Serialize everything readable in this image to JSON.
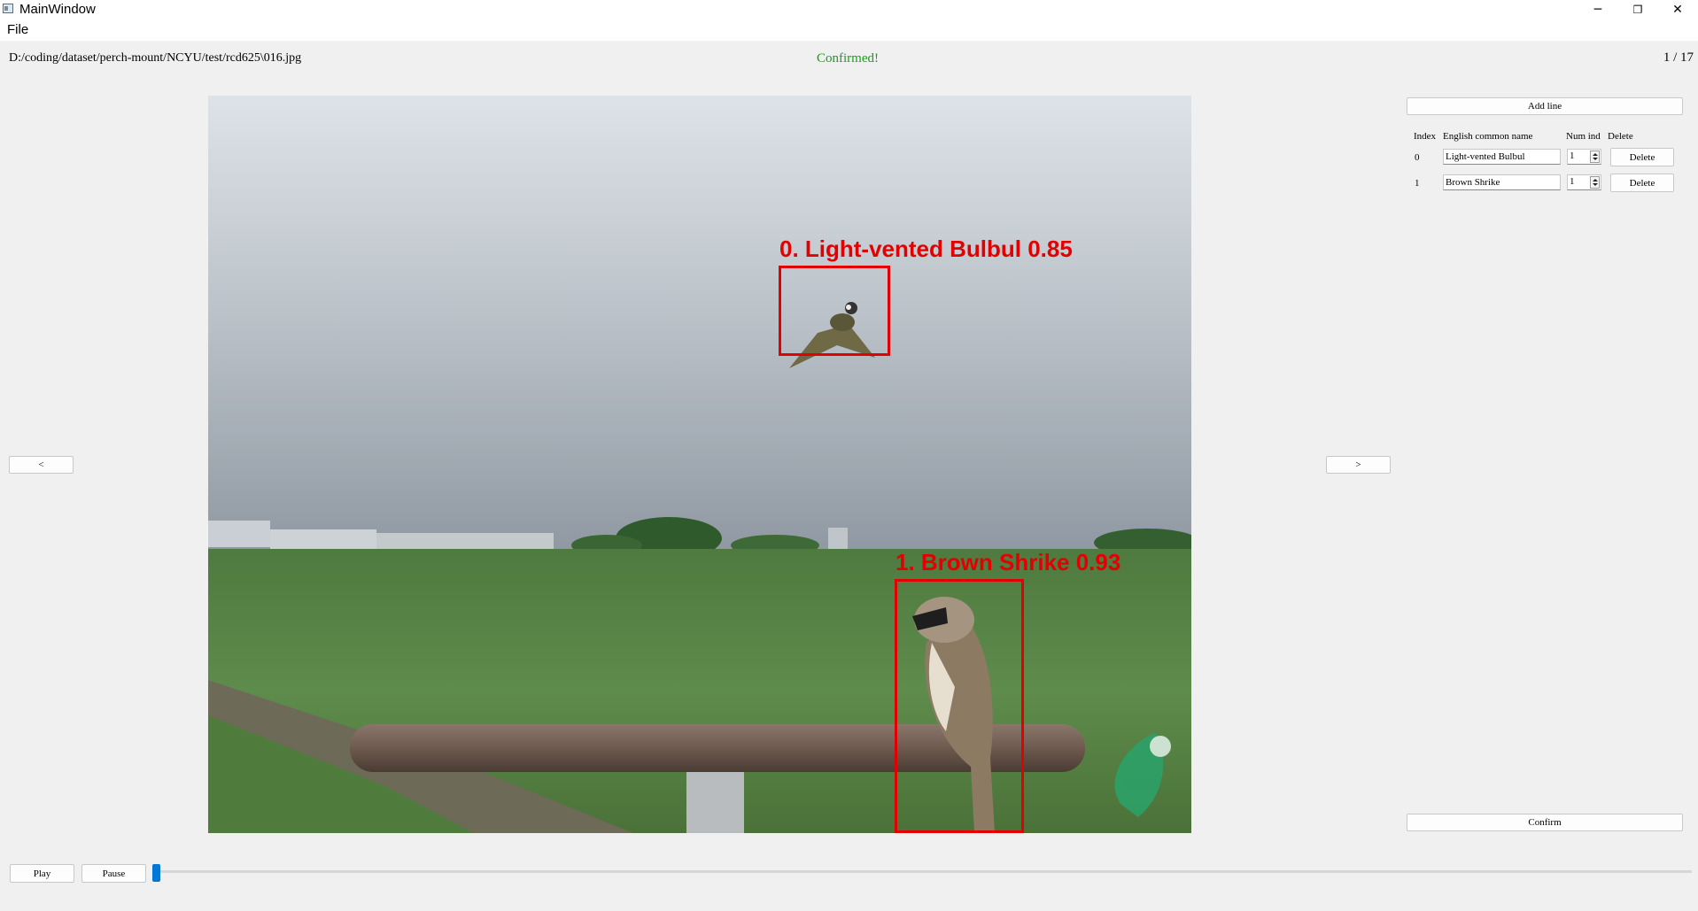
{
  "window": {
    "title": "MainWindow",
    "minimize_glyph": "─",
    "restore_glyph": "❐",
    "close_glyph": "✕"
  },
  "menu": {
    "file": "File"
  },
  "header": {
    "path": "D:/coding/dataset/perch-mount/NCYU/test/rcd625\\016.jpg",
    "status": "Confirmed!",
    "status_color": "#18a018",
    "counter": "1 / 17"
  },
  "nav": {
    "prev": "<",
    "next": ">"
  },
  "detections": [
    {
      "label": "0. Light-vented Bulbul 0.85"
    },
    {
      "label": "1. Brown Shrike 0.93"
    }
  ],
  "panel": {
    "add_line": "Add line",
    "headers": {
      "index": "Index",
      "name": "English common name",
      "num": "Num ind",
      "delete": "Delete"
    },
    "rows": [
      {
        "index": "0",
        "name": "Light-vented Bulbul",
        "num": "1",
        "delete": "Delete"
      },
      {
        "index": "1",
        "name": "Brown Shrike",
        "num": "1",
        "delete": "Delete"
      }
    ],
    "confirm": "Confirm"
  },
  "playback": {
    "play": "Play",
    "pause": "Pause",
    "progress": 0.0
  },
  "colors": {
    "accent": "#0078d7",
    "detection": "#e30000"
  }
}
